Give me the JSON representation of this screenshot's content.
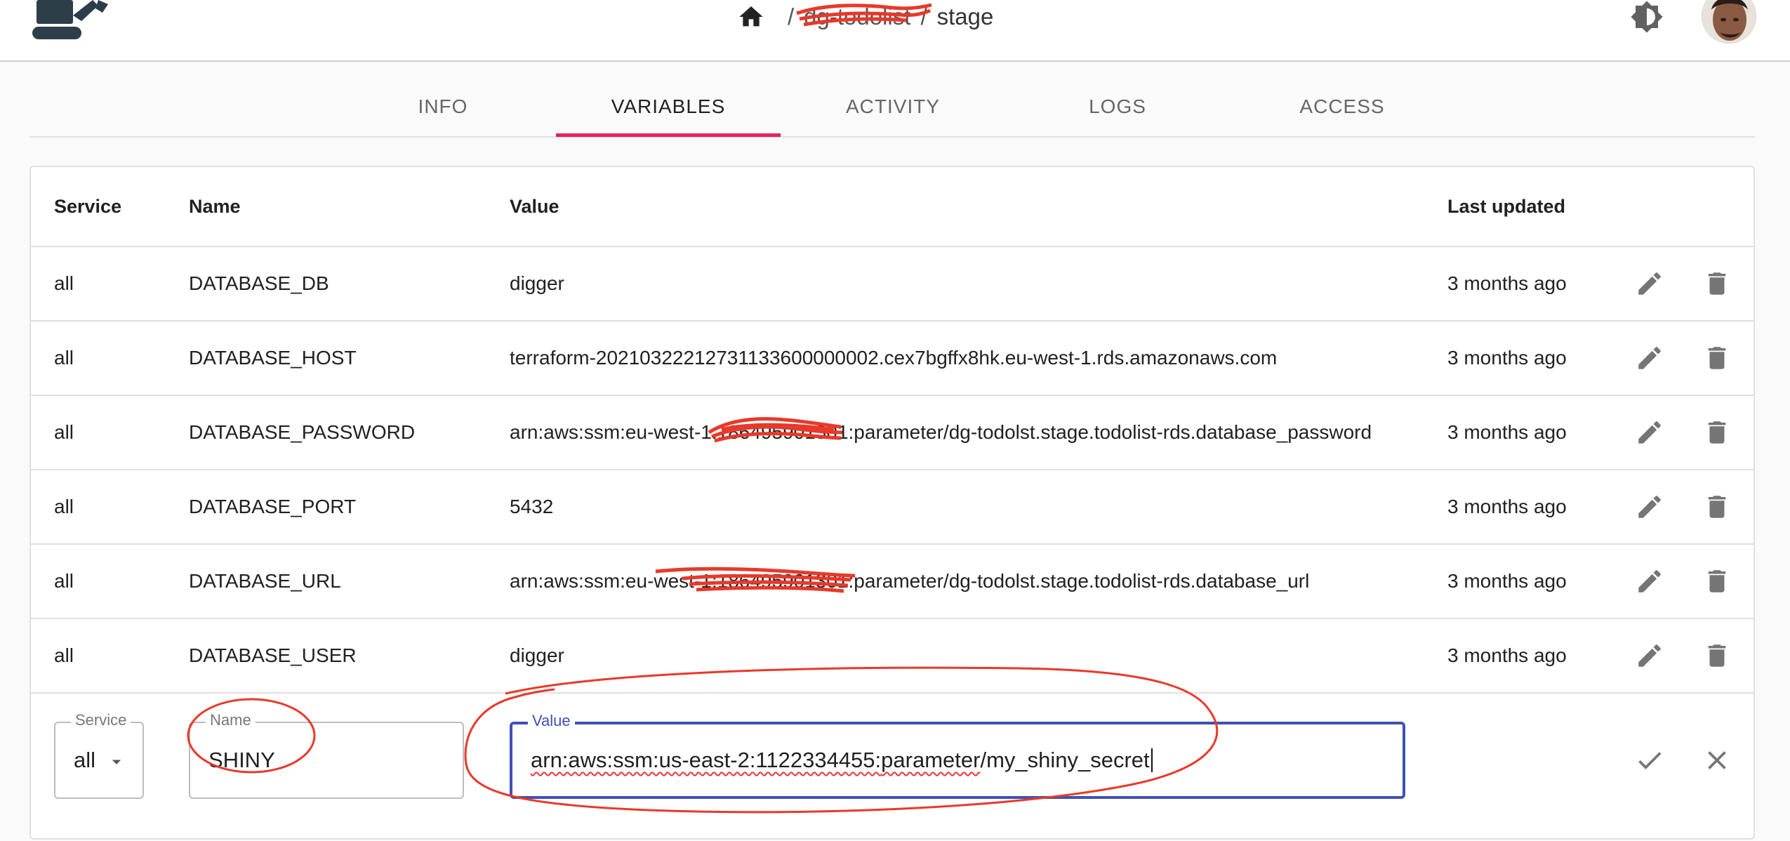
{
  "header": {
    "breadcrumb_project": "dg-todolist",
    "breadcrumb_separator": "/",
    "breadcrumb_environment": "stage"
  },
  "tabs": [
    {
      "label": "INFO",
      "active": false
    },
    {
      "label": "VARIABLES",
      "active": true
    },
    {
      "label": "ACTIVITY",
      "active": false
    },
    {
      "label": "LOGS",
      "active": false
    },
    {
      "label": "ACCESS",
      "active": false
    }
  ],
  "table": {
    "columns": {
      "service": "Service",
      "name": "Name",
      "value": "Value",
      "last_updated": "Last updated"
    },
    "rows": [
      {
        "service": "all",
        "name": "DATABASE_DB",
        "value": "digger",
        "last_updated": "3 months ago"
      },
      {
        "service": "all",
        "name": "DATABASE_HOST",
        "value": "terraform-20210322212731133600000002.cex7bgffx8hk.eu-west-1.rds.amazonaws.com",
        "last_updated": "3 months ago"
      },
      {
        "service": "all",
        "name": "DATABASE_PASSWORD",
        "value_prefix": "arn:aws:ssm:eu-west-1",
        "value_redacted": ":186495901301",
        "value_suffix": ":parameter/dg-todolst.stage.todolist-rds.database_password",
        "last_updated": "3 months ago"
      },
      {
        "service": "all",
        "name": "DATABASE_PORT",
        "value": "5432",
        "last_updated": "3 months ago"
      },
      {
        "service": "all",
        "name": "DATABASE_URL",
        "value_prefix": "arn:aws:ssm:eu-west-1:",
        "value_redacted": "186495901301",
        "value_suffix": ":parameter/dg-todolst.stage.todolist-rds.database_url",
        "last_updated": "3 months ago"
      },
      {
        "service": "all",
        "name": "DATABASE_USER",
        "value": "digger",
        "last_updated": "3 months ago"
      }
    ]
  },
  "new_variable": {
    "service_label": "Service",
    "service_value": "all",
    "name_label": "Name",
    "name_value": "SHINY",
    "value_label": "Value",
    "value_part1": "arn:aws:ssm:us-east-2:1122334455:",
    "value_part2": "parameter",
    "value_part3": "/my_shiny_secret"
  },
  "colors": {
    "accent": "#e91e63",
    "focus": "#3f51b5",
    "icon": "#757575",
    "annotation": "#e8392a"
  },
  "icons": [
    "excavator-logo",
    "home-icon",
    "brightness-icon",
    "avatar",
    "pencil-icon",
    "trash-icon",
    "chevron-down-icon",
    "check-icon",
    "close-icon"
  ]
}
